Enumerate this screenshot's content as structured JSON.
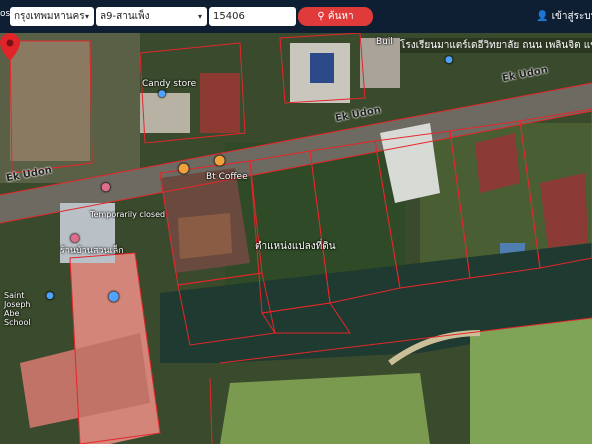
{
  "header": {
    "left_label": "os",
    "province": "กรุงเทพมหานคร",
    "district": "ล9-สานเพ็ง",
    "postcode": "15406",
    "search_label": "ค้นหา",
    "login_label": "เข้าสู่ระบบ/ล"
  },
  "map": {
    "top_place_label": "โรงเรียนมาแตร์เดอีวิทยาลัย ถนน เพลินจิต แขวง",
    "road_labels": [
      "Ek Udon",
      "Ek Udon",
      "Ek Udon"
    ],
    "places": {
      "candy": "Candy store",
      "bt_coffee": "Bt Coffee",
      "temporarily_closed": "Temporarily closed",
      "shop_thai": "ร้านบ้านสวนเล็ก",
      "school": "Saint Joseph Abe School",
      "plot_label": "ตำแหน่งแปลงที่ดิน",
      "build": "Buil"
    },
    "colors": {
      "parcel_line": "#e5262a",
      "pin": "#e0242a"
    }
  }
}
